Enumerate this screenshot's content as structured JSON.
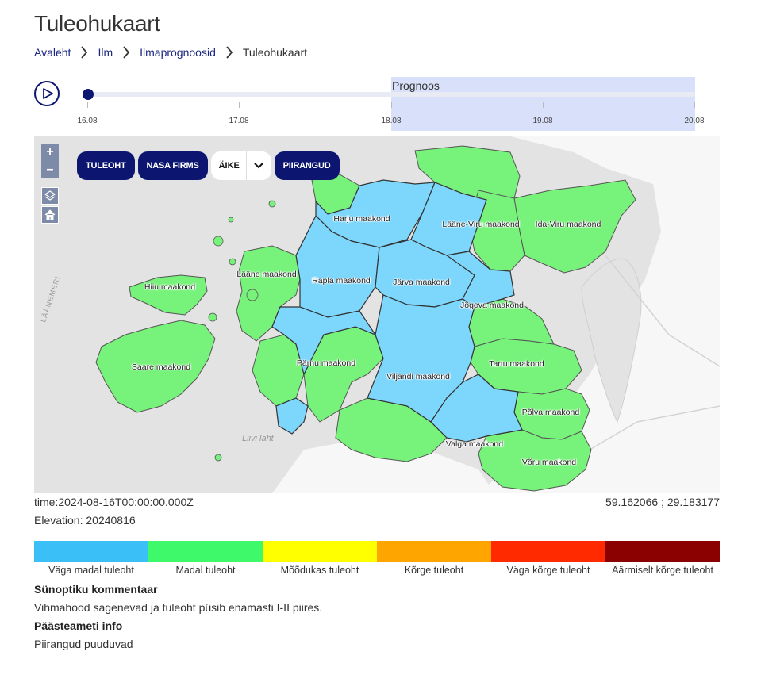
{
  "page": {
    "title": "Tuleohukaart"
  },
  "breadcrumb": [
    {
      "label": "Avaleht"
    },
    {
      "label": "Ilm"
    },
    {
      "label": "Ilmaprognoosid"
    },
    {
      "label": "Tuleohukaart"
    }
  ],
  "timeline": {
    "forecast_label": "Prognoos",
    "dates": [
      "16.08",
      "17.08",
      "18.08",
      "19.08",
      "20.08"
    ],
    "current_index": 0,
    "forecast_start_index": 2
  },
  "map": {
    "zoom_in": "+",
    "zoom_out": "–",
    "buttons": {
      "fire": "TULEOHT",
      "nasa": "NASA FIRMS",
      "area_select": "ÄIKE",
      "restrictions": "PIIRANGUD"
    },
    "counties": [
      {
        "name": "Harju maakond",
        "level": 0
      },
      {
        "name": "Lääne-Viru maakond",
        "level": 0
      },
      {
        "name": "Ida-Viru maakond",
        "level": 1
      },
      {
        "name": "Hiiu maakond",
        "level": 1
      },
      {
        "name": "Lääne maakond",
        "level": 1
      },
      {
        "name": "Rapla maakond",
        "level": 0
      },
      {
        "name": "Järva maakond",
        "level": 0
      },
      {
        "name": "Jõgeva maakond",
        "level": 0
      },
      {
        "name": "Saare maakond",
        "level": 1
      },
      {
        "name": "Pärnu maakond",
        "level": 0
      },
      {
        "name": "Tartu maakond",
        "level": 1
      },
      {
        "name": "Viljandi maakond",
        "level": 0
      },
      {
        "name": "Põlva maakond",
        "level": 1
      },
      {
        "name": "Valga maakond",
        "level": 0
      },
      {
        "name": "Võru maakond",
        "level": 1
      }
    ],
    "sea_labels": [
      "Liivi laht",
      "LÄÄNEMERI"
    ]
  },
  "readouts": {
    "time": "time:2024-08-16T00:00:00.000Z",
    "coords": "59.162066 ; 29.183177",
    "elevation": "Elevation: 20240816"
  },
  "legend": [
    {
      "label": "Väga madal tuleoht",
      "color": "#3bbff7"
    },
    {
      "label": "Madal tuleoht",
      "color": "#3ef96a"
    },
    {
      "label": "Mõõdukas tuleoht",
      "color": "#ffff00"
    },
    {
      "label": "Kõrge tuleoht",
      "color": "#ffa500"
    },
    {
      "label": "Väga kõrge tuleoht",
      "color": "#ff2a00"
    },
    {
      "label": "Äärmiselt kõrge tuleoht",
      "color": "#8b0000"
    }
  ],
  "synoptic": {
    "heading": "Sünoptiku kommentaar",
    "text": "Vihmahood sagenevad ja tuleoht püsib enamasti I-II piires."
  },
  "rescue": {
    "heading": "Päästeameti info",
    "text": "Piirangud puuduvad"
  },
  "colors": {
    "brand": "#0c1670",
    "very_low": "#7dd6fb",
    "low": "#77f27a",
    "land": "#f7f7f7",
    "sea": "#e3e3e3"
  }
}
